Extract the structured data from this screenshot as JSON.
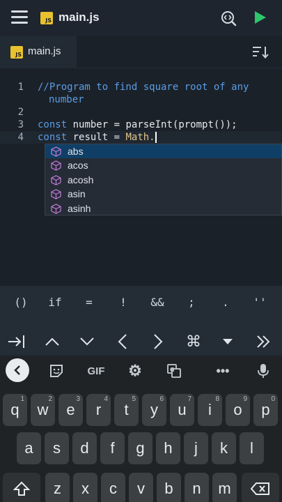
{
  "app": {
    "title": "main.js",
    "badge": "JS"
  },
  "tab": {
    "label": "main.js",
    "badge": "JS"
  },
  "editor": {
    "line_numbers": [
      "1",
      "2",
      "3",
      "4"
    ],
    "line1a": "//Program to find square root of any",
    "line1b": "number",
    "line3": {
      "kw": "const",
      "name": "number",
      "eq": " = ",
      "fn": "parseInt(prompt());"
    },
    "line4": {
      "kw": "const",
      "name": "result",
      "eq": " = ",
      "obj": "Math."
    }
  },
  "autocomplete": [
    "abs",
    "acos",
    "acosh",
    "asin",
    "asinh"
  ],
  "symbols": [
    "()",
    "if",
    "=",
    "!",
    "&&",
    ";",
    ".",
    "''"
  ],
  "keyboard": {
    "gif": "GIF",
    "row1": [
      {
        "k": "q",
        "h": "1"
      },
      {
        "k": "w",
        "h": "2"
      },
      {
        "k": "e",
        "h": "3"
      },
      {
        "k": "r",
        "h": "4"
      },
      {
        "k": "t",
        "h": "5"
      },
      {
        "k": "y",
        "h": "6"
      },
      {
        "k": "u",
        "h": "7"
      },
      {
        "k": "i",
        "h": "8"
      },
      {
        "k": "o",
        "h": "9"
      },
      {
        "k": "p",
        "h": "0"
      }
    ],
    "row2": [
      "a",
      "s",
      "d",
      "f",
      "g",
      "h",
      "j",
      "k",
      "l"
    ],
    "row3": [
      "z",
      "x",
      "c",
      "v",
      "b",
      "n",
      "m"
    ]
  }
}
